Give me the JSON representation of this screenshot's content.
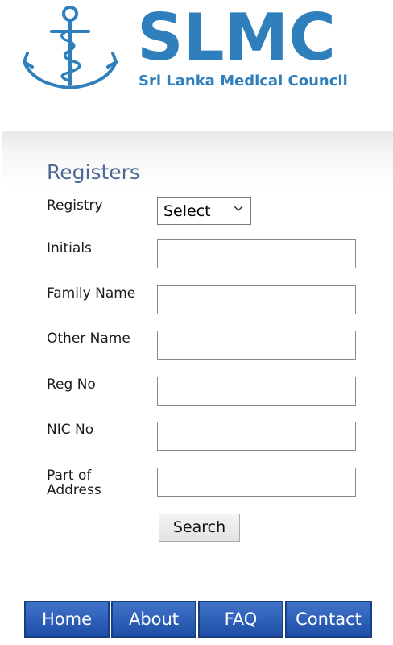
{
  "header": {
    "brand_name": "SLMC",
    "brand_subtitle": "Sri Lanka Medical Council",
    "logo_icon": "anchor-caduceus-icon",
    "brand_color": "#2f7fbd"
  },
  "form": {
    "title": "Registers",
    "registry": {
      "label": "Registry",
      "selected": "Select"
    },
    "initials": {
      "label": "Initials",
      "value": ""
    },
    "family_name": {
      "label": "Family Name",
      "value": ""
    },
    "other_name": {
      "label": "Other Name",
      "value": ""
    },
    "reg_no": {
      "label": "Reg No",
      "value": ""
    },
    "nic_no": {
      "label": "NIC No",
      "value": ""
    },
    "address": {
      "label_line1": "Part of",
      "label_line2": "Address",
      "value": ""
    },
    "search_label": "Search"
  },
  "nav": {
    "items": [
      {
        "label": "Home"
      },
      {
        "label": "About"
      },
      {
        "label": "FAQ"
      },
      {
        "label": "Contact"
      }
    ],
    "color": "#2a5db8"
  }
}
